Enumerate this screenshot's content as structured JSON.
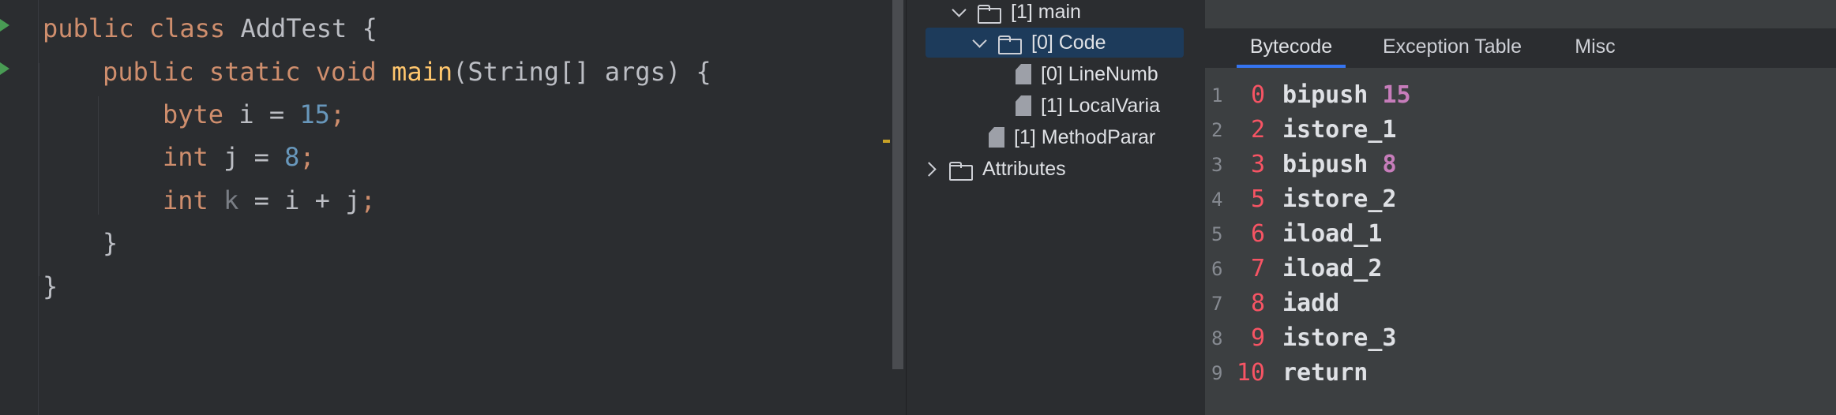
{
  "editor": {
    "lines": [
      {
        "tokens": [
          {
            "t": "public class ",
            "c": "kw"
          },
          {
            "t": "AddTest {",
            "c": "txt"
          }
        ]
      },
      {
        "tokens": [
          {
            "t": "public static void ",
            "c": "kw"
          },
          {
            "t": "main",
            "c": "fn"
          },
          {
            "t": "(String[] args) {",
            "c": "txt"
          }
        ]
      },
      {
        "tokens": [
          {
            "t": "byte ",
            "c": "kw"
          },
          {
            "t": "i = ",
            "c": "txt"
          },
          {
            "t": "15",
            "c": "num"
          },
          {
            "t": ";",
            "c": "kw"
          }
        ]
      },
      {
        "tokens": [
          {
            "t": "int ",
            "c": "kw"
          },
          {
            "t": "j = ",
            "c": "txt"
          },
          {
            "t": "8",
            "c": "num"
          },
          {
            "t": ";",
            "c": "kw"
          }
        ]
      },
      {
        "tokens": [
          {
            "t": "int ",
            "c": "kw"
          },
          {
            "t": "k",
            "c": "unused"
          },
          {
            "t": " = i + j",
            "c": "txt"
          },
          {
            "t": ";",
            "c": "kw"
          }
        ]
      },
      {
        "tokens": [
          {
            "t": "}",
            "c": "txt"
          }
        ]
      },
      {
        "tokens": [
          {
            "t": "}",
            "c": "txt"
          }
        ]
      }
    ]
  },
  "tree": {
    "items": [
      {
        "label": "[1] main",
        "icon": "folder-icon",
        "expander": "down"
      },
      {
        "label": "[0] Code",
        "icon": "folder-icon",
        "expander": "down",
        "selected": true
      },
      {
        "label": "[0] LineNumb",
        "icon": "file-icon"
      },
      {
        "label": "[1] LocalVaria",
        "icon": "file-icon"
      },
      {
        "label": "[1] MethodParar",
        "icon": "file-icon"
      },
      {
        "label": "Attributes",
        "icon": "folder-icon",
        "expander": "right"
      }
    ]
  },
  "tabs": [
    {
      "label": "Bytecode",
      "active": true
    },
    {
      "label": "Exception Table",
      "active": false
    },
    {
      "label": "Misc",
      "active": false
    }
  ],
  "bytecode": [
    {
      "line": "1",
      "offset": "0",
      "instr": "bipush",
      "arg": "15"
    },
    {
      "line": "2",
      "offset": "2",
      "instr": "istore_1",
      "arg": ""
    },
    {
      "line": "3",
      "offset": "3",
      "instr": "bipush",
      "arg": "8"
    },
    {
      "line": "4",
      "offset": "5",
      "instr": "istore_2",
      "arg": ""
    },
    {
      "line": "5",
      "offset": "6",
      "instr": "iload_1",
      "arg": ""
    },
    {
      "line": "6",
      "offset": "7",
      "instr": "iload_2",
      "arg": ""
    },
    {
      "line": "7",
      "offset": "8",
      "instr": "iadd",
      "arg": ""
    },
    {
      "line": "8",
      "offset": "9",
      "instr": "istore_3",
      "arg": ""
    },
    {
      "line": "9",
      "offset": "10",
      "instr": "return",
      "arg": ""
    }
  ]
}
